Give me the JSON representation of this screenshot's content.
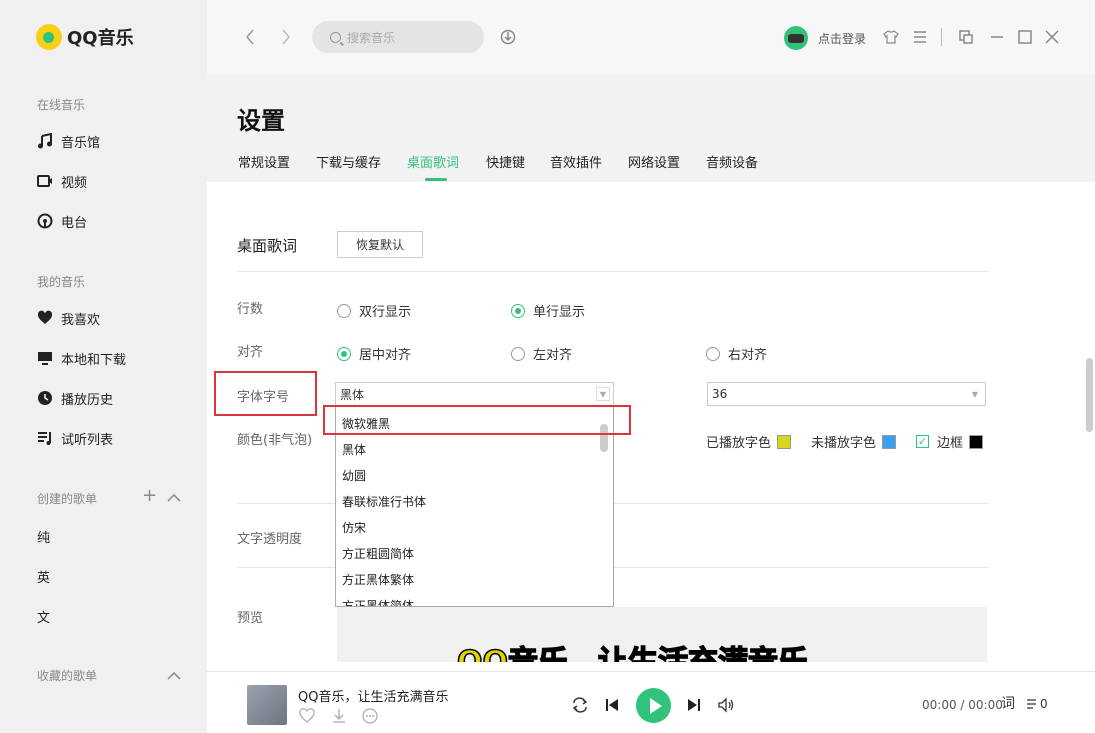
{
  "app": {
    "name": "QQ音乐"
  },
  "sidebar": {
    "online_title": "在线音乐",
    "online_items": [
      {
        "label": "音乐馆",
        "icon": "music-note-icon"
      },
      {
        "label": "视频",
        "icon": "video-icon"
      },
      {
        "label": "电台",
        "icon": "radio-icon"
      }
    ],
    "my_title": "我的音乐",
    "my_items": [
      {
        "label": "我喜欢",
        "icon": "heart-icon"
      },
      {
        "label": "本地和下载",
        "icon": "monitor-icon"
      },
      {
        "label": "播放历史",
        "icon": "clock-icon"
      },
      {
        "label": "试听列表",
        "icon": "playlist-icon"
      }
    ],
    "created_title": "创建的歌单",
    "created_items": [
      "纯",
      "英",
      "文"
    ],
    "collected_title": "收藏的歌单"
  },
  "topbar": {
    "search_placeholder": "搜索音乐",
    "login": "点击登录"
  },
  "settings": {
    "title": "设置",
    "tabs": [
      "常规设置",
      "下载与缓存",
      "桌面歌词",
      "快捷键",
      "音效插件",
      "网络设置",
      "音频设备"
    ],
    "active_tab": "桌面歌词",
    "section_title": "桌面歌词",
    "reset_button": "恢复默认",
    "rows_label": "行数",
    "rows_options": [
      "双行显示",
      "单行显示"
    ],
    "rows_selected": "单行显示",
    "align_label": "对齐",
    "align_options": [
      "居中对齐",
      "左对齐",
      "右对齐"
    ],
    "align_selected": "居中对齐",
    "font_label": "字体字号",
    "font_value": "黑体",
    "font_options": [
      "微软雅黑",
      "黑体",
      "幼圆",
      "春联标准行书体",
      "仿宋",
      "方正粗圆简体",
      "方正黑体繁体",
      "方正黑体简体"
    ],
    "size_value": "36",
    "color_label": "颜色(非气泡)",
    "played_color_label": "已播放字色",
    "played_color": "#d4d91e",
    "unplayed_color_label": "未播放字色",
    "unplayed_color": "#3aa0f0",
    "border_label": "边框",
    "border_color": "#000000",
    "opacity_label": "文字透明度",
    "preview_label": "预览",
    "preview_text_a": "QQ音乐，",
    "preview_text_b": "让生活充满音乐"
  },
  "player": {
    "song": "QQ音乐，让生活充满音乐",
    "time": "00:00 / 00:00",
    "lyric_btn": "词",
    "playlist_count": "0"
  },
  "colors": {
    "accent": "#31c27c",
    "highlight_box": "#d9363e"
  }
}
